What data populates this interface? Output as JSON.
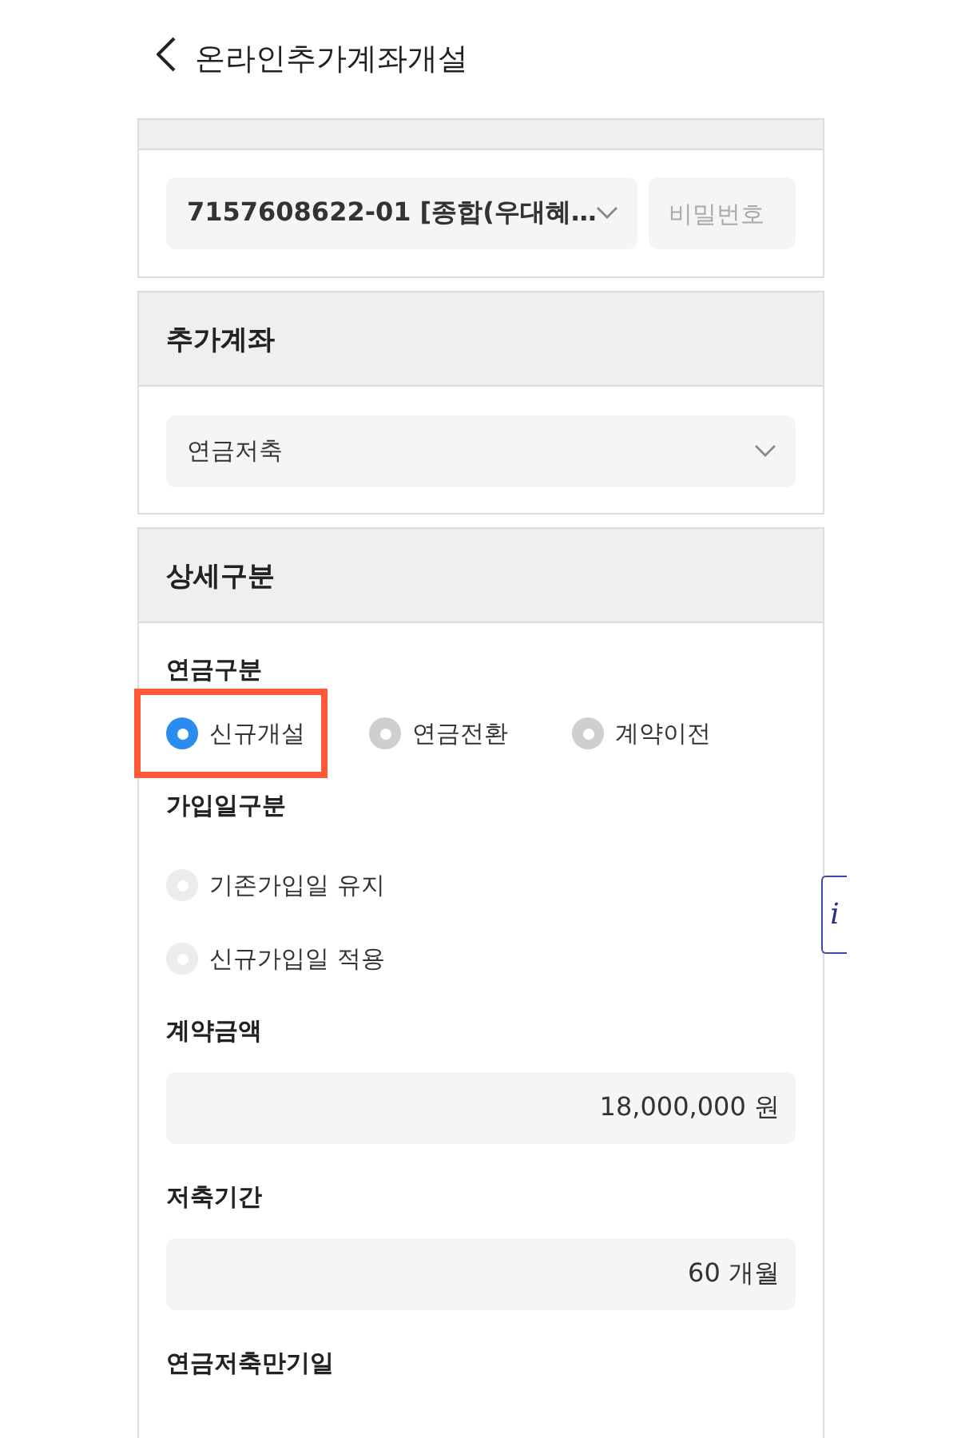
{
  "header": {
    "title": "온라인추가계좌개설"
  },
  "account": {
    "value": "7157608622-01 [종합(우대혜…",
    "password_placeholder": "비밀번호"
  },
  "additional_account": {
    "title": "추가계좌",
    "value": "연금저축"
  },
  "details": {
    "title": "상세구분",
    "groups": [
      {
        "label": "연금구분",
        "kind": "inline",
        "options": [
          {
            "label": "신규개설",
            "selected": true,
            "disabled": false,
            "highlighted": true
          },
          {
            "label": "연금전환",
            "selected": false,
            "disabled": false,
            "highlighted": false
          },
          {
            "label": "계약이전",
            "selected": false,
            "disabled": false,
            "highlighted": false
          }
        ]
      },
      {
        "label": "가입일구분",
        "kind": "stacked",
        "options": [
          {
            "label": "기존가입일 유지",
            "selected": false,
            "disabled": true,
            "highlighted": false
          },
          {
            "label": "신규가입일 적용",
            "selected": false,
            "disabled": true,
            "highlighted": false
          }
        ]
      }
    ],
    "fields": [
      {
        "label": "계약금액",
        "value": "18,000,000 원"
      },
      {
        "label": "저축기간",
        "value": "60 개월"
      }
    ],
    "trailing_label": "연금저축만기일"
  },
  "info_tab": {
    "label": "i"
  }
}
